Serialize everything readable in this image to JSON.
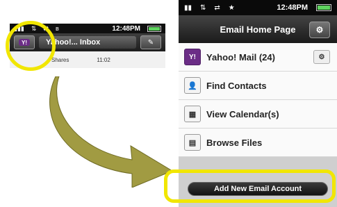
{
  "left": {
    "status": {
      "time": "12:48PM"
    },
    "toolbar": {
      "title": "Yahoo!... Inbox",
      "y_label": "Y!"
    },
    "row": {
      "text_left": "Shares",
      "text_right": "11:02"
    }
  },
  "right": {
    "status": {
      "time": "12:48PM"
    },
    "header": {
      "title": "Email Home Page"
    },
    "items": [
      {
        "label": "Yahoo! Mail (24)",
        "icon": "yahoo-icon"
      },
      {
        "label": "Find Contacts",
        "icon": "contacts-icon"
      },
      {
        "label": "View Calendar(s)",
        "icon": "calendar-icon"
      },
      {
        "label": "Browse Files",
        "icon": "files-icon"
      }
    ],
    "add_account_label": "Add New Email Account"
  },
  "colors": {
    "highlight": "#f1e600",
    "arrow": "#a19b42",
    "yahoo": "#6b2d86"
  }
}
